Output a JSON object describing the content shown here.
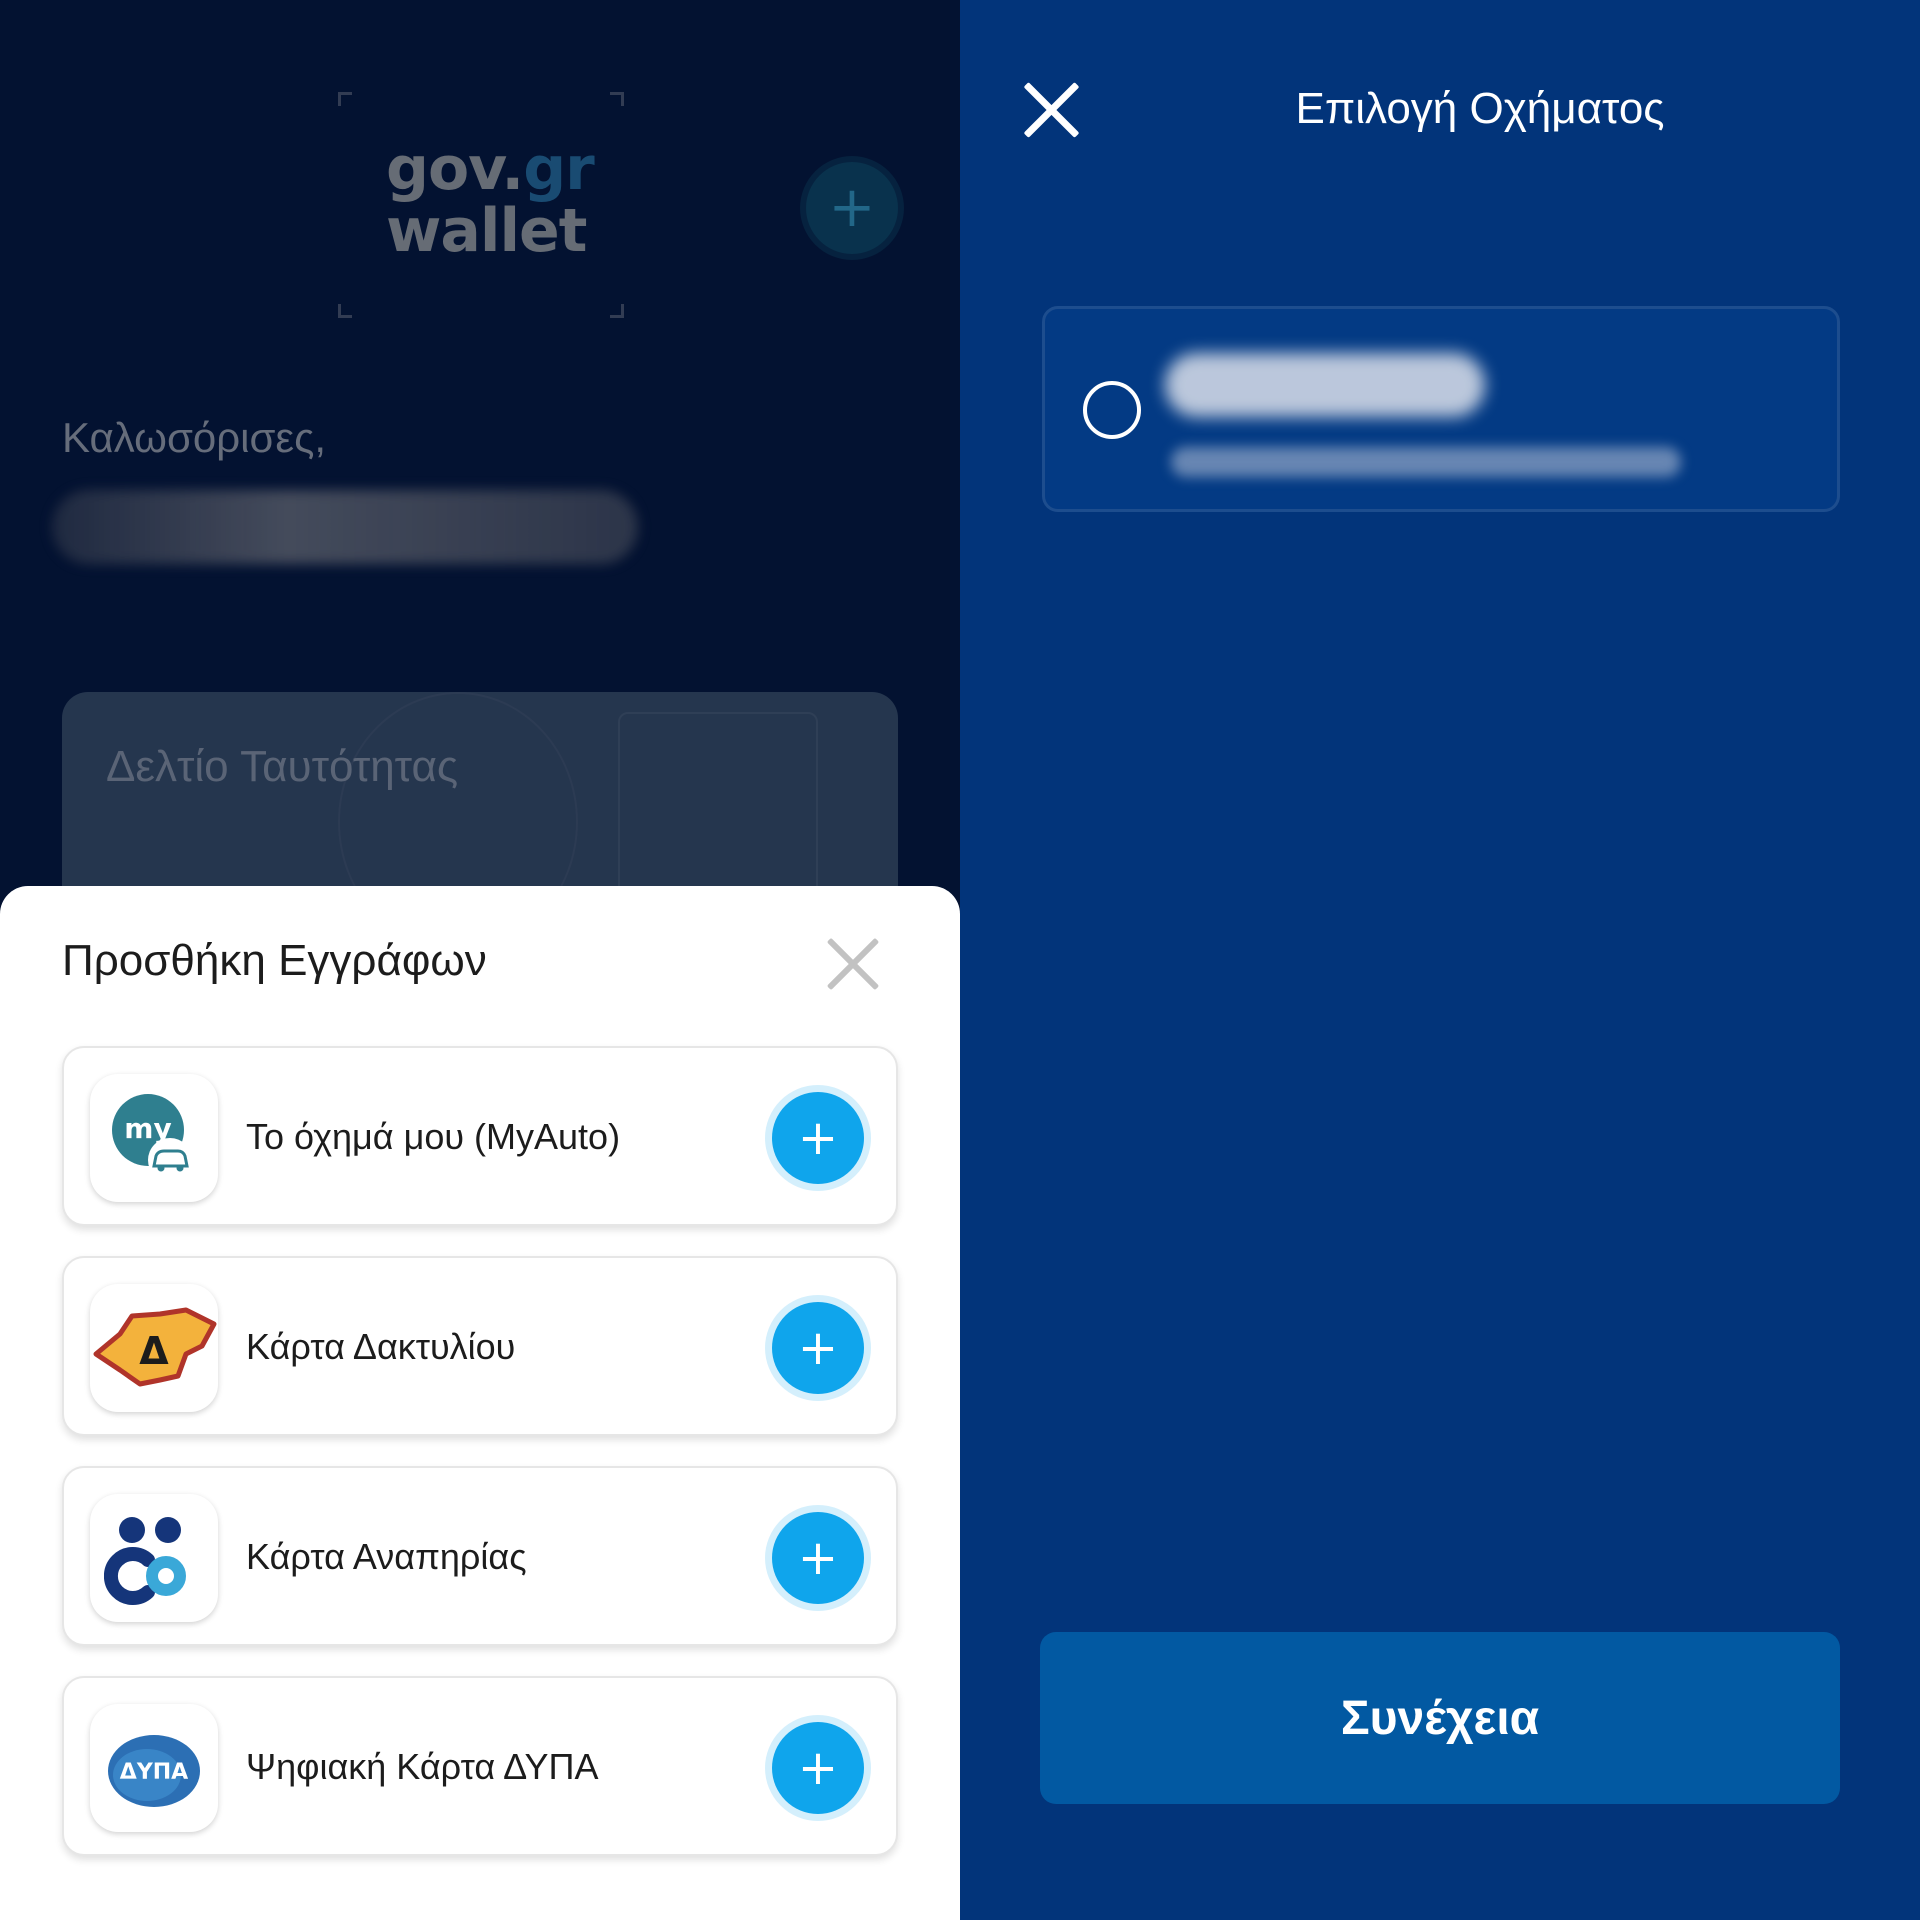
{
  "wallet": {
    "logo_line1_a": "gov.",
    "logo_line1_b": "gr",
    "logo_line2": "wallet",
    "welcome": "Καλωσόρισες,",
    "id_card_title": "Δελτίο Ταυτότητας"
  },
  "sheet": {
    "title": "Προσθήκη Εγγράφων",
    "items": [
      {
        "label": "Το όχημά μου (MyAuto)",
        "icon": "myauto-icon"
      },
      {
        "label": "Κάρτα Δακτυλίου",
        "icon": "ring-road-card-icon"
      },
      {
        "label": "Κάρτα Αναπηρίας",
        "icon": "disability-card-icon"
      },
      {
        "label": "Ψηφιακή Κάρτα ΔΥΠΑ",
        "icon": "dypa-card-icon"
      }
    ],
    "myauto_icon_text": "my",
    "ring_icon_text": "Δ",
    "dypa_icon_text": "ΔΥΠΑ"
  },
  "vehicle_select": {
    "title": "Επιλογή Οχήματος",
    "continue_label": "Συνέχεια"
  },
  "colors": {
    "accent": "#0fa5ec",
    "right_bg": "#02347a",
    "left_bg": "#04163c",
    "button": "#0259a2"
  }
}
